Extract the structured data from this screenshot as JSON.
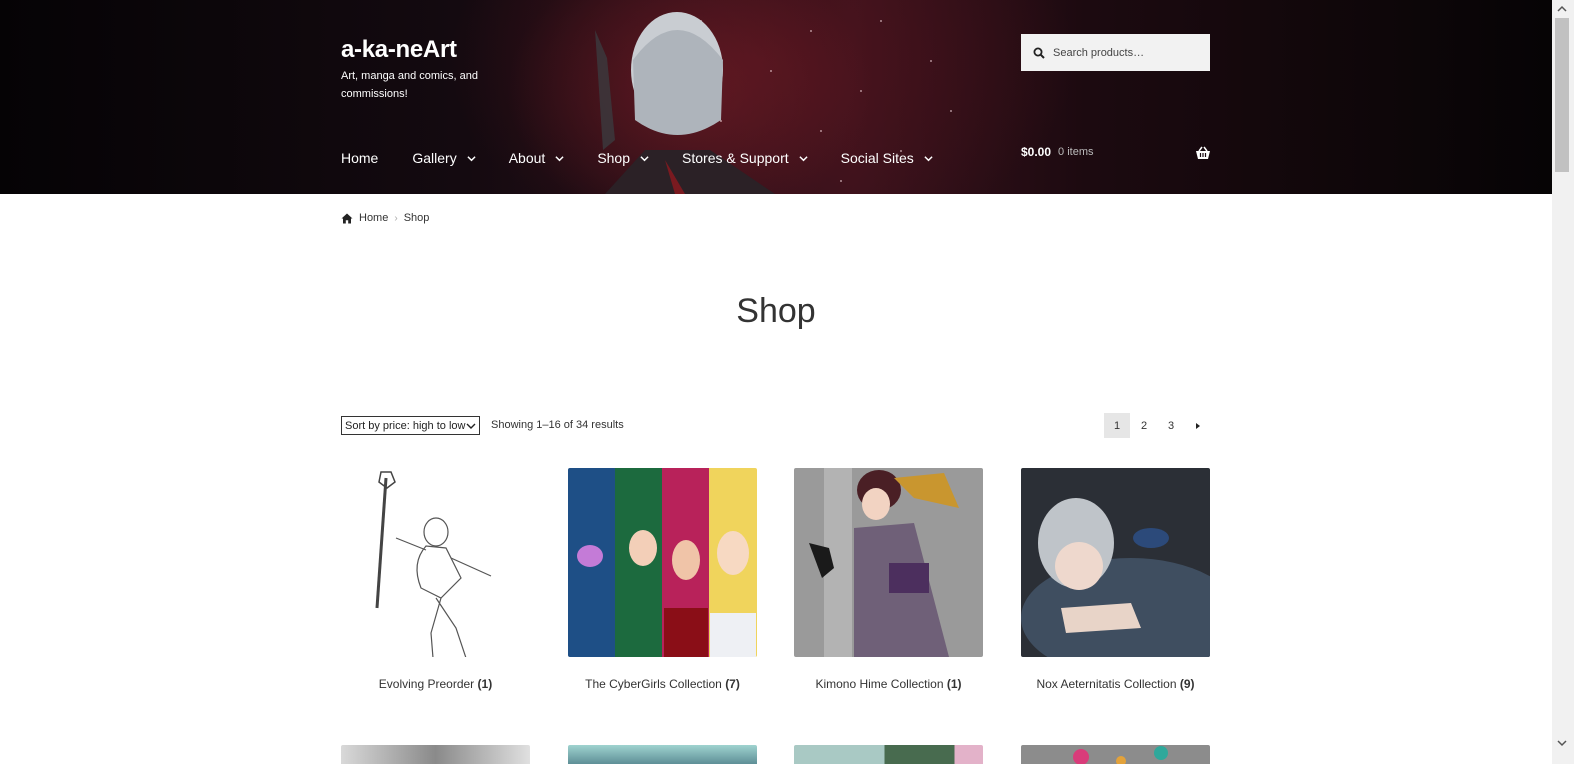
{
  "site": {
    "title": "a-ka-neArt",
    "description": "Art, manga and comics, and commissions!"
  },
  "search": {
    "placeholder": "Search products…"
  },
  "nav": {
    "items": [
      {
        "label": "Home",
        "has_dropdown": false
      },
      {
        "label": "Gallery",
        "has_dropdown": true
      },
      {
        "label": "About",
        "has_dropdown": true
      },
      {
        "label": "Shop",
        "has_dropdown": true
      },
      {
        "label": "Stores & Support",
        "has_dropdown": true
      },
      {
        "label": "Social Sites",
        "has_dropdown": true
      }
    ]
  },
  "cart": {
    "amount": "$0.00",
    "items": "0 items",
    "icon": "basket-icon"
  },
  "breadcrumb": {
    "home": "Home",
    "current": "Shop"
  },
  "page": {
    "title": "Shop"
  },
  "toolbar": {
    "sort_selected": "Sort by price: high to low",
    "result_count": "Showing 1–16 of 34 results"
  },
  "pagination": {
    "pages": [
      "1",
      "2",
      "3"
    ],
    "current": "1",
    "next_icon": "triangle-right-icon"
  },
  "products": [
    {
      "name": "Evolving Preorder",
      "count": "(1)"
    },
    {
      "name": "The CyberGirls Collection",
      "count": "(7)"
    },
    {
      "name": "Kimono Hime Collection",
      "count": "(1)"
    },
    {
      "name": "Nox Aeternitatis Collection",
      "count": "(9)"
    }
  ],
  "colors": {
    "header_bg": "#1a0a10",
    "text": "#333333",
    "pagination_current_bg": "#e6e6e6",
    "search_bg": "#f2f2f2"
  }
}
